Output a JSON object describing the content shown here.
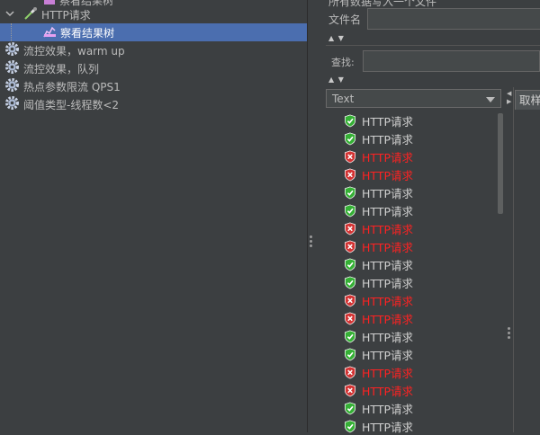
{
  "tree": {
    "items": [
      {
        "label": "察看结果树",
        "icon": "graph-icon",
        "partial": true
      },
      {
        "label": "HTTP请求",
        "icon": "pipette-icon"
      },
      {
        "label": "察看结果树",
        "icon": "graph-icon",
        "selected": true
      },
      {
        "label": "流控效果，warm up",
        "icon": "gear-icon"
      },
      {
        "label": "流控效果，队列",
        "icon": "gear-icon"
      },
      {
        "label": "热点参数限流 QPS1",
        "icon": "gear-icon"
      },
      {
        "label": "阈值类型-线程数<2",
        "icon": "gear-icon"
      }
    ]
  },
  "right": {
    "top_note": "所有数据写入一个文件",
    "filename_label": "文件名",
    "filename_value": "",
    "search_label": "查找:",
    "search_value": "",
    "renderer_select": "Text",
    "sample_tab_label": "取样"
  },
  "results": [
    {
      "label": "HTTP请求",
      "status": "success"
    },
    {
      "label": "HTTP请求",
      "status": "success"
    },
    {
      "label": "HTTP请求",
      "status": "failure"
    },
    {
      "label": "HTTP请求",
      "status": "failure"
    },
    {
      "label": "HTTP请求",
      "status": "success"
    },
    {
      "label": "HTTP请求",
      "status": "success"
    },
    {
      "label": "HTTP请求",
      "status": "failure"
    },
    {
      "label": "HTTP请求",
      "status": "failure"
    },
    {
      "label": "HTTP请求",
      "status": "success"
    },
    {
      "label": "HTTP请求",
      "status": "success"
    },
    {
      "label": "HTTP请求",
      "status": "failure"
    },
    {
      "label": "HTTP请求",
      "status": "failure"
    },
    {
      "label": "HTTP请求",
      "status": "success"
    },
    {
      "label": "HTTP请求",
      "status": "success"
    },
    {
      "label": "HTTP请求",
      "status": "failure"
    },
    {
      "label": "HTTP请求",
      "status": "failure"
    },
    {
      "label": "HTTP请求",
      "status": "success"
    },
    {
      "label": "HTTP请求",
      "status": "success"
    }
  ],
  "colors": {
    "success": "#35b035",
    "failure": "#d33333",
    "selection": "#4b6eaf"
  }
}
